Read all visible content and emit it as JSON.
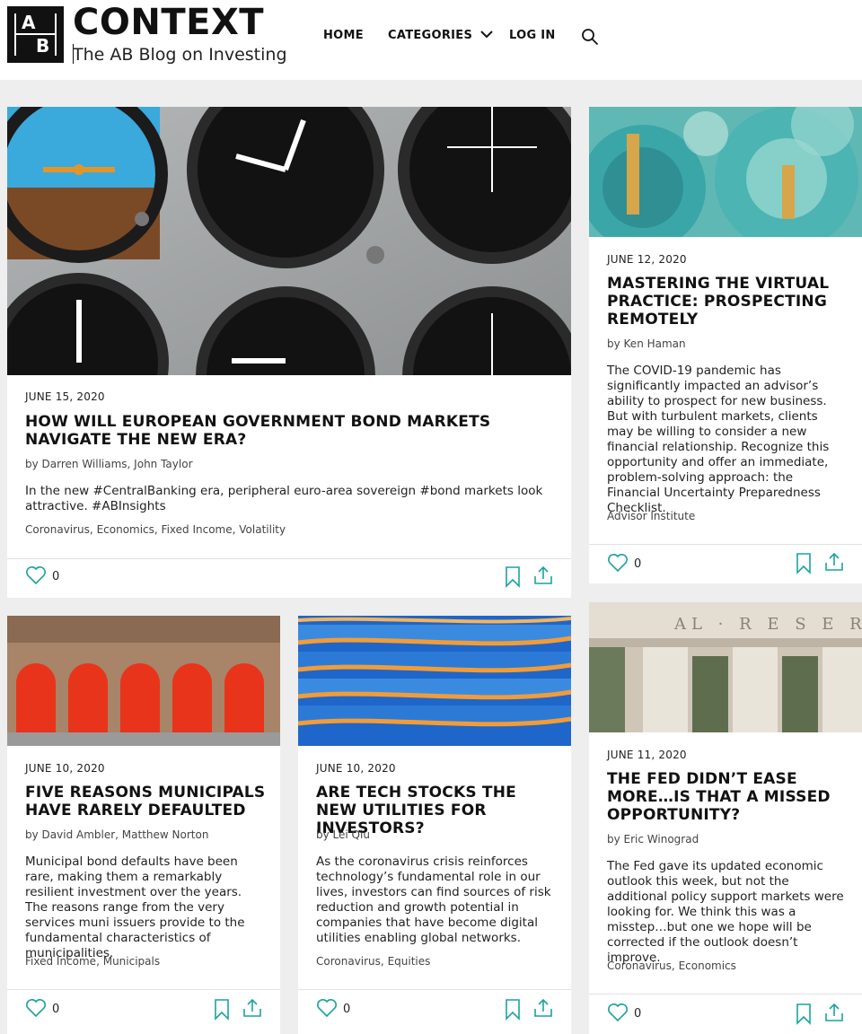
{
  "brand": {
    "logo_letters": [
      "A",
      "B"
    ],
    "title": "CONTEXT",
    "subtitle": "The AB Blog on Investing"
  },
  "nav": {
    "home": "HOME",
    "categories": "CATEGORIES",
    "login": "LOG IN"
  },
  "colors": {
    "accent": "#1aa39a",
    "background": "#eeeeee",
    "card": "#ffffff"
  },
  "posts": [
    {
      "date": "JUNE 15, 2020",
      "title": "HOW WILL EUROPEAN GOVERNMENT BOND MARKETS NAVIGATE THE NEW ERA?",
      "authors": "by Darren Williams, John Taylor",
      "excerpt": "In the new #CentralBanking era, peripheral euro-area sovereign #bond markets look attractive. #ABInsights",
      "tags": [
        "Coronavirus",
        "Economics",
        "Fixed Income",
        "Volatility"
      ],
      "likes": "0",
      "image": "cockpit-instruments"
    },
    {
      "date": "JUNE 12, 2020",
      "title": "MASTERING THE VIRTUAL PRACTICE: PROSPECTING REMOTELY",
      "authors": "by Ken Haman",
      "excerpt": "The COVID-19 pandemic has significantly impacted an advisor’s ability to prospect for new business. But with turbulent markets, clients may be willing to consider a new financial relationship. Recognize this opportunity and offer an immediate, problem-solving approach: the Financial Uncertainty Preparedness Checklist.",
      "tags": [
        "Advisor Institute"
      ],
      "likes": "0",
      "image": "gears"
    },
    {
      "date": "JUNE 10, 2020",
      "title": "FIVE REASONS MUNICIPALS HAVE RARELY DEFAULTED",
      "authors": "by David Ambler, Matthew Norton",
      "excerpt": "Municipal bond defaults have been rare, making them a remarkably resilient investment over the years. The reasons range from the very services muni issuers provide to the fundamental characteristics of municipalities.",
      "tags": [
        "Fixed Income",
        "Municipals"
      ],
      "likes": "0",
      "image": "fire-station"
    },
    {
      "date": "JUNE 10, 2020",
      "title": "ARE TECH STOCKS THE NEW UTILITIES FOR INVESTORS?",
      "authors": "by Lei Qiu",
      "excerpt": "As the coronavirus crisis reinforces technology’s fundamental role in our lives, investors can find sources of risk reduction and growth potential in companies that have become digital utilities enabling global networks.",
      "tags": [
        "Coronavirus",
        "Equities"
      ],
      "likes": "0",
      "image": "network-switch"
    },
    {
      "date": "JUNE 11, 2020",
      "title": "THE FED DIDN’T EASE MORE…IS THAT A MISSED OPPORTUNITY?",
      "authors": "by Eric Winograd",
      "excerpt": "The Fed gave its updated economic outlook this week, but not the additional policy support markets were looking for. We think this was a misstep…but one we hope will be corrected if the outlook doesn’t improve.",
      "tags": [
        "Coronavirus",
        "Economics"
      ],
      "likes": "0",
      "image": "federal-reserve",
      "image_text": "AL · R E S E R V E"
    }
  ]
}
